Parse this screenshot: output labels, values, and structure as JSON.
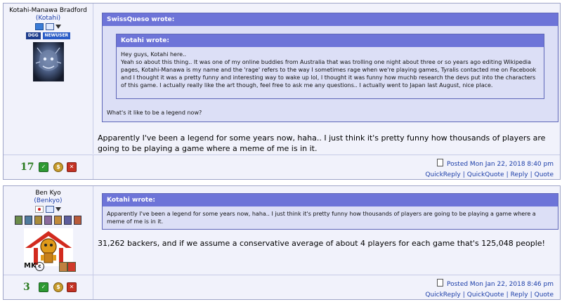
{
  "posts": [
    {
      "user": {
        "name": "Kotahi-Manawa Bradford",
        "login": "(Kotahi)",
        "rank_badges": [
          "DGG",
          "NEWUSER"
        ]
      },
      "outer_quote": {
        "header": "SwissQueso wrote:",
        "tail": "What's it like to be a legend now?"
      },
      "inner_quote": {
        "header": "Kotahi wrote:",
        "text": "Hey guys, Kotahi here..\nYeah so about this thing.. It was one of my online buddies from Australia that was trolling one night about three or so years ago editing Wikipedia pages, Kotahi-Manawa is my name and the 'rage' refers to the way I sometimes rage when we're playing games, Tyralis contacted me on Facebook and I thought it was a pretty funny and interesting way to wake up lol, I thought it was funny how muchb research the devs put into the characters of this game. I actually really like the art though, feel free to ask me any questions.. I actually went to Japan last August, nice place."
      },
      "message": "Apparently I've been a legend for some years now, haha.. I just think it's pretty funny how thousands of players are going to be playing a game where a meme of me is in it.",
      "reputation": "17",
      "posted": "Posted Mon Jan 22, 2018 8:40 pm",
      "actions": [
        "QuickReply",
        "QuickQuote",
        "Reply",
        "Quote"
      ]
    },
    {
      "user": {
        "name": "Ben Kyo",
        "login": "(Benkyo)",
        "extra_badges": [
          "MK"
        ]
      },
      "quote": {
        "header": "Kotahi wrote:",
        "text": "Apparently I've been a legend for some years now, haha.. I just think it's pretty funny how thousands of players are going to be playing a game where a meme of me is in it."
      },
      "message": "31,262 backers, and if we assume a conservative average of about 4 players for each game that's 125,048 people!",
      "reputation": "3",
      "posted": "Posted Mon Jan 22, 2018 8:46 pm",
      "actions": [
        "QuickReply",
        "QuickQuote",
        "Reply",
        "Quote"
      ]
    }
  ],
  "colors": {
    "link": "#1c3ea8",
    "quote_header": "#6d74d8",
    "quote_bg": "#dcdff6",
    "post_bg": "#f1f2fb",
    "reputation": "#2a7a1f"
  }
}
